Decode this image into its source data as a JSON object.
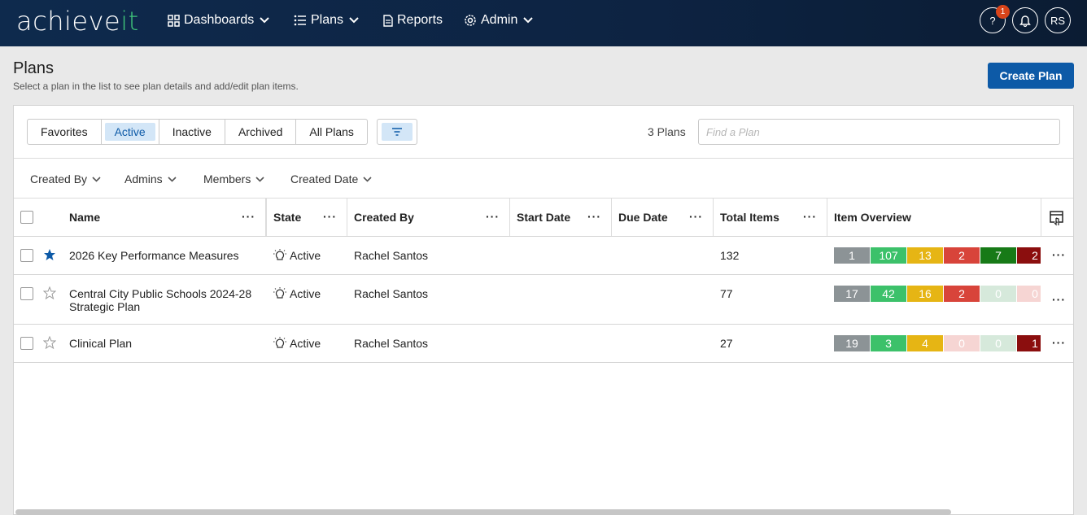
{
  "nav": {
    "logo_main": "achieve",
    "logo_accent": "it",
    "dashboards": "Dashboards",
    "plans": "Plans",
    "reports": "Reports",
    "admin": "Admin",
    "help_badge": "1",
    "user_initials": "RS"
  },
  "header": {
    "title": "Plans",
    "subtitle": "Select a plan in the list to see plan details and add/edit plan items.",
    "create_label": "Create Plan"
  },
  "toolbar": {
    "tabs": [
      "Favorites",
      "Active",
      "Inactive",
      "Archived",
      "All Plans"
    ],
    "active_tab": "Active",
    "plan_count": "3 Plans",
    "search_placeholder": "Find a Plan"
  },
  "filters": [
    "Created By",
    "Admins",
    "Members",
    "Created Date"
  ],
  "columns": {
    "name": "Name",
    "state": "State",
    "created_by": "Created By",
    "start_date": "Start Date",
    "due_date": "Due Date",
    "total_items": "Total Items",
    "item_overview": "Item Overview"
  },
  "status_colors": {
    "gray": "#8c9396",
    "light_green": "#3cc16a",
    "yellow": "#e6b514",
    "red": "#d8443a",
    "dark_green": "#177a17",
    "dark_red": "#8b0e0e",
    "faded_green": "#d6e9db",
    "faded_red": "#f6d5d3",
    "accent_blue": "#0d5aa7"
  },
  "rows": [
    {
      "favorite": true,
      "name_line1": "2026 Key Performance Measures",
      "name_line2": "",
      "state": "Active",
      "created_by": "Rachel Santos",
      "start_date": "",
      "due_date": "",
      "total_items": "132",
      "overview": [
        "1",
        "107",
        "13",
        "2",
        "7",
        "2"
      ]
    },
    {
      "favorite": false,
      "name_line1": "Central City Public Schools 2024-28",
      "name_line2": "Strategic Plan",
      "state": "Active",
      "created_by": "Rachel Santos",
      "start_date": "",
      "due_date": "",
      "total_items": "77",
      "overview": [
        "17",
        "42",
        "16",
        "2",
        "0",
        "0"
      ]
    },
    {
      "favorite": false,
      "name_line1": "Clinical Plan",
      "name_line2": "",
      "state": "Active",
      "created_by": "Rachel Santos",
      "start_date": "",
      "due_date": "",
      "total_items": "27",
      "overview": [
        "19",
        "3",
        "4",
        "0",
        "0",
        "1"
      ]
    }
  ]
}
